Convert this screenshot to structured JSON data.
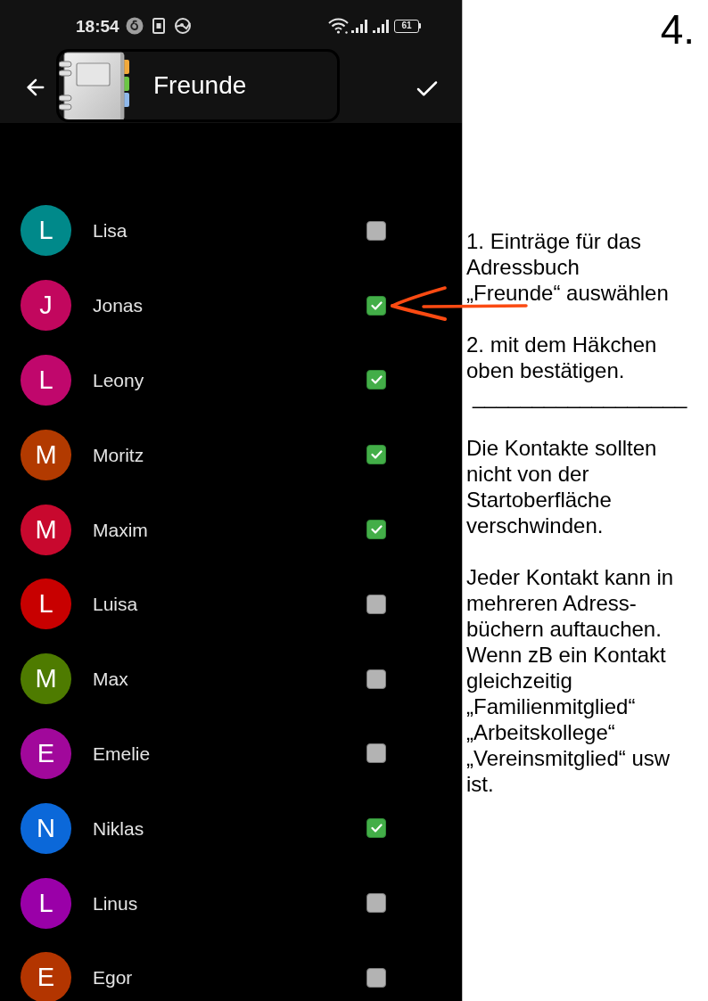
{
  "status_bar": {
    "time": "18:54",
    "battery": "61"
  },
  "header": {
    "title": "Freunde"
  },
  "contacts": [
    {
      "initial": "L",
      "name": "Lisa",
      "color": "#00898a",
      "checked": false
    },
    {
      "initial": "J",
      "name": "Jonas",
      "color": "#c2075e",
      "checked": true
    },
    {
      "initial": "L",
      "name": "Leony",
      "color": "#c0076c",
      "checked": true
    },
    {
      "initial": "M",
      "name": "Moritz",
      "color": "#b23a00",
      "checked": true
    },
    {
      "initial": "M",
      "name": "Maxim",
      "color": "#c8082e",
      "checked": true
    },
    {
      "initial": "L",
      "name": "Luisa",
      "color": "#c80000",
      "checked": false
    },
    {
      "initial": "M",
      "name": "Max",
      "color": "#4e7b00",
      "checked": false
    },
    {
      "initial": "E",
      "name": "Emelie",
      "color": "#a1089b",
      "checked": false
    },
    {
      "initial": "N",
      "name": "Niklas",
      "color": "#0b68d9",
      "checked": true
    },
    {
      "initial": "L",
      "name": "Linus",
      "color": "#9a00a8",
      "checked": false
    },
    {
      "initial": "E",
      "name": "Egor",
      "color": "#b33500",
      "checked": false
    }
  ],
  "step_label": "4.",
  "notes": [
    {
      "kind": "paragraph",
      "lines": [
        "1. Einträge für das",
        "Adressbuch",
        "„Freunde“ auswählen"
      ]
    },
    {
      "kind": "paragraph",
      "lines": [
        "2. mit dem Häkchen",
        "oben bestätigen."
      ]
    },
    {
      "kind": "rule",
      "text": "__________________"
    },
    {
      "kind": "paragraph",
      "lines": [
        "Die Kontakte sollten",
        "nicht von der",
        "Startoberfläche",
        "verschwinden."
      ]
    },
    {
      "kind": "paragraph",
      "lines": [
        "Jeder Kontakt kann in",
        "mehreren Adress-",
        "büchern auftauchen.",
        "Wenn zB ein Kontakt",
        "gleichzeitig",
        "„Familienmitglied“",
        "„Arbeitskollege“",
        "„Vereinsmitglied“ usw",
        "ist."
      ]
    }
  ]
}
